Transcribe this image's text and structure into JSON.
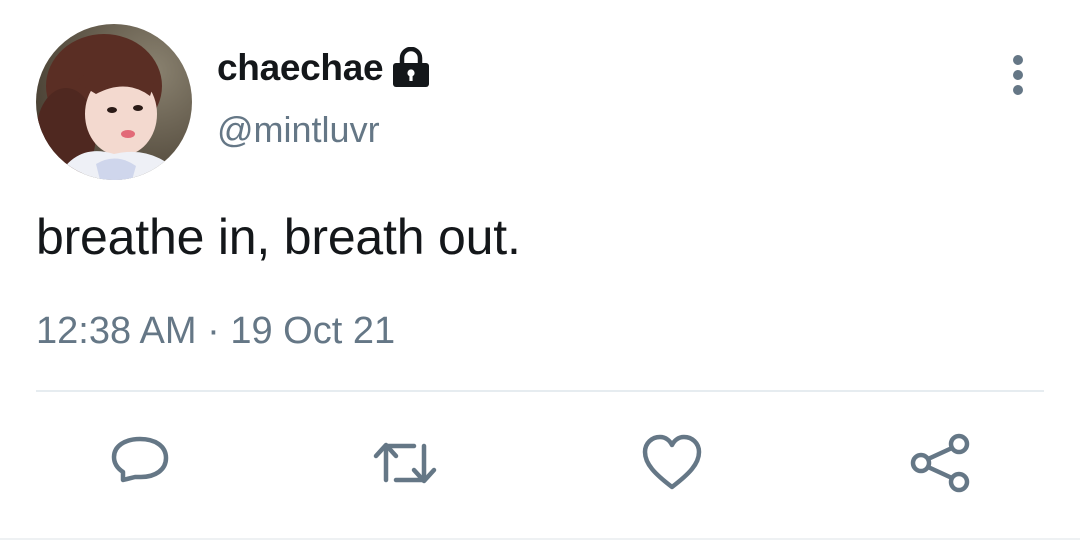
{
  "user": {
    "display_name": "chaechae",
    "handle": "@mintluvr",
    "avatar_icon": "profile-photo",
    "protected_icon": "lock-icon"
  },
  "tweet": {
    "text": "breathe in, breath out.",
    "timestamp": "12:38 AM · 19 Oct 21"
  },
  "actions": [
    {
      "name": "reply",
      "icon": "reply-icon"
    },
    {
      "name": "retweet",
      "icon": "retweet-icon"
    },
    {
      "name": "like",
      "icon": "heart-icon"
    },
    {
      "name": "share",
      "icon": "share-icon"
    }
  ],
  "colors": {
    "text_primary": "#14171a",
    "text_secondary": "#657786",
    "icon": "#657786",
    "divider": "#e6ecf0"
  }
}
